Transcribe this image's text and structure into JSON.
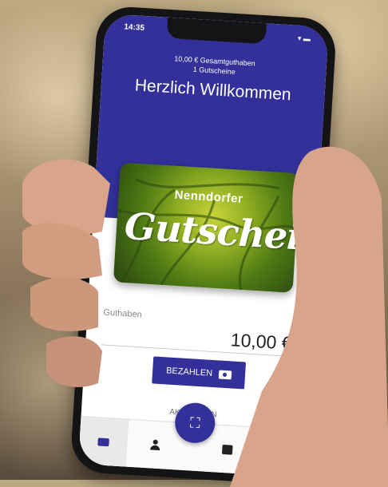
{
  "status_bar": {
    "time": "14:35",
    "icons": "▾ ▬"
  },
  "header": {
    "balance_total": "10,00 € Gesamtguthaben",
    "vouchers_count": "1 Gutscheine",
    "welcome": "Herzlich Willkommen"
  },
  "card": {
    "brand_line": "Nenndorfer",
    "main_text": "Gutschein"
  },
  "balance": {
    "label": "Guthaben",
    "value": "10,00 €"
  },
  "actions": {
    "pay_label": "BEZAHLEN",
    "activate_label": "AKTIVIEREN"
  },
  "fab": {
    "icon": "⛶"
  },
  "nav": {
    "cart_icon": "🛒"
  },
  "colors": {
    "brand": "#33309a"
  }
}
